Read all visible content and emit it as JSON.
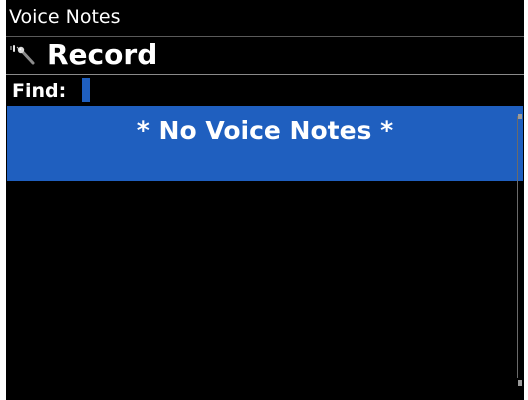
{
  "app": {
    "title": "Voice Notes"
  },
  "actions": {
    "record": {
      "label": "Record",
      "icon": "microphone-icon"
    }
  },
  "search": {
    "label": "Find:",
    "value": ""
  },
  "list": {
    "empty_message": "* No Voice Notes *"
  },
  "colors": {
    "background": "#000000",
    "highlight": "#1f5fbf",
    "text": "#ffffff"
  }
}
